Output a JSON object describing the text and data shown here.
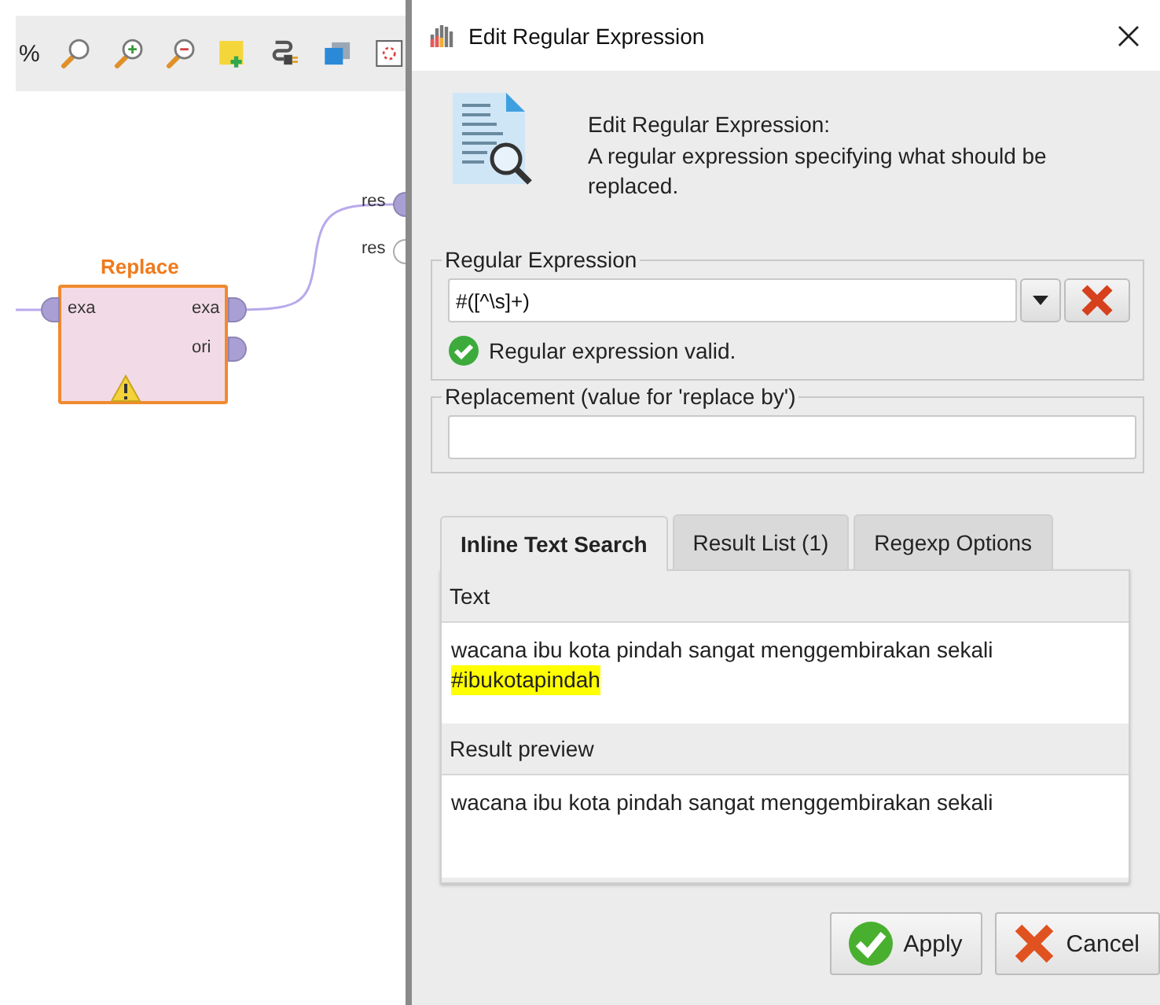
{
  "toolbar": {
    "zoom_label": "%",
    "tools": [
      {
        "kind": "zoom-fit"
      },
      {
        "kind": "zoom-in"
      },
      {
        "kind": "zoom-out"
      },
      {
        "kind": "add-note"
      },
      {
        "kind": "plug"
      },
      {
        "kind": "layers"
      },
      {
        "kind": "fit-frame"
      }
    ]
  },
  "canvas": {
    "operator": {
      "title": "Replace",
      "inputs": [
        {
          "label": "exa",
          "filled": true
        }
      ],
      "outputs": [
        {
          "label": "exa",
          "filled": true
        },
        {
          "label": "ori",
          "filled": true
        }
      ],
      "warning": true
    },
    "result_ports": [
      {
        "label": "res",
        "filled": true
      },
      {
        "label": "res",
        "filled": false
      }
    ]
  },
  "dialog": {
    "title": "Edit Regular Expression",
    "description": {
      "heading": "Edit Regular Expression:",
      "text": "A regular expression specifying what should be replaced."
    },
    "regex_group": {
      "legend": "Regular Expression",
      "value": "#([^\\s]+)",
      "status": "Regular expression valid.",
      "valid": true
    },
    "replacement_group": {
      "legend": "Replacement (value for 'replace by')"
    },
    "tabs": [
      {
        "label": "Inline Text Search",
        "selected": true
      },
      {
        "label": "Result List (1)",
        "selected": false
      },
      {
        "label": "Regexp Options",
        "selected": false
      }
    ],
    "text_section": {
      "heading": "Text",
      "text": "wacana ibu kota pindah sangat menggembirakan sekali",
      "match": "#ibukotapindah"
    },
    "preview_section": {
      "heading": "Result preview",
      "text": "wacana ibu kota pindah sangat menggembirakan sekali"
    },
    "buttons": [
      {
        "label": "Apply",
        "kind": "apply"
      },
      {
        "label": "Cancel",
        "kind": "cancel"
      }
    ]
  }
}
